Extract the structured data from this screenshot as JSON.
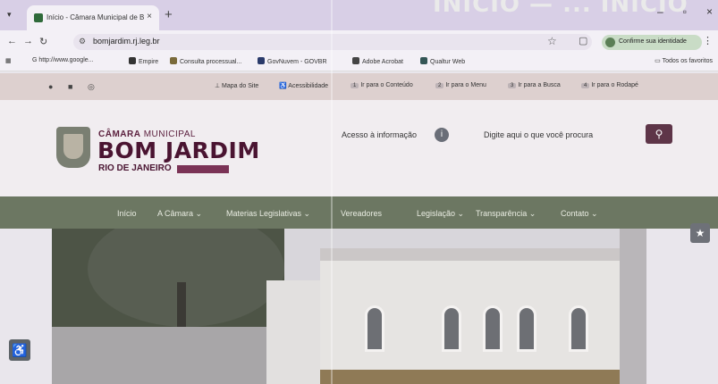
{
  "browser": {
    "tab_title": "Início - Câmara Municipal de B",
    "url": "bomjardim.rj.leg.br",
    "identity_label": "Confirme sua identidade",
    "overlay_title": "INÍCIO — ... ÍNÍCIO",
    "bookmarks": [
      "G http://www.google...",
      "Empire",
      "Consulta processual...",
      "GovNuvem - GOVBR",
      "Adobe Acrobat",
      "Qualtur Web"
    ],
    "bookmarks_folder": "Todos os favoritos"
  },
  "utility": {
    "site_map": "Mapa do Site",
    "accessibility": "Acessibilidade",
    "links": [
      {
        "key": "1",
        "label": "Ir para o Conteúdo"
      },
      {
        "key": "2",
        "label": "Ir para o Menu"
      },
      {
        "key": "3",
        "label": "Ir para a Busca"
      },
      {
        "key": "4",
        "label": "Ir para o Rodapé"
      }
    ]
  },
  "header": {
    "logo_line1_bold": "CÂMARA",
    "logo_line1_light": " MUNICIPAL",
    "logo_line2": "BOM JARDIM",
    "logo_line3": "RIO DE JANEIRO",
    "access_label": "Acesso à informação",
    "search_placeholder": "Digite aqui o que você procura"
  },
  "nav": [
    {
      "label": "Início"
    },
    {
      "label": "A Câmara ⌄"
    },
    {
      "label": "Materias Legislativas ⌄"
    },
    {
      "label": "Vereadores"
    },
    {
      "label": "Legislação ⌄"
    },
    {
      "label": "Transparência ⌄"
    },
    {
      "label": "Contato ⌄"
    }
  ],
  "colors": {
    "brand": "#4a1431",
    "navbar": "#6c7762",
    "search_button": "#5e3548"
  }
}
